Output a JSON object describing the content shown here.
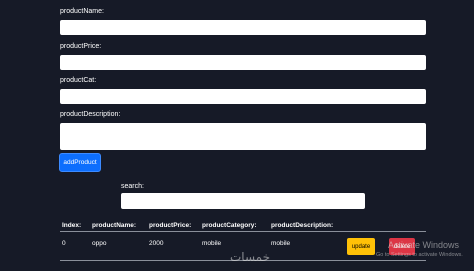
{
  "form": {
    "name_label": "productName:",
    "name_value": "",
    "price_label": "productPrice:",
    "price_value": "",
    "cat_label": "productCat:",
    "cat_value": "",
    "description_label": "productDescription:",
    "description_value": "",
    "add_button": "addProduct"
  },
  "search": {
    "label": "search:",
    "value": ""
  },
  "table": {
    "headers": [
      "Index:",
      "productName:",
      "productPrice:",
      "productCategory:",
      "productDescription:"
    ],
    "rows": [
      {
        "index": "0",
        "name": "oppo",
        "price": "2000",
        "category": "mobile",
        "description": "mobile",
        "update_label": "update",
        "delete_label": "delete"
      }
    ]
  },
  "overlay": {
    "activate_title": "Activate Windows",
    "activate_sub": "Go to Settings to activate Windows.",
    "watermark": "خمسات"
  },
  "colors": {
    "background": "#161a27",
    "primary": "#0d6efd",
    "warning": "#ffc107",
    "danger": "#dc3545"
  }
}
